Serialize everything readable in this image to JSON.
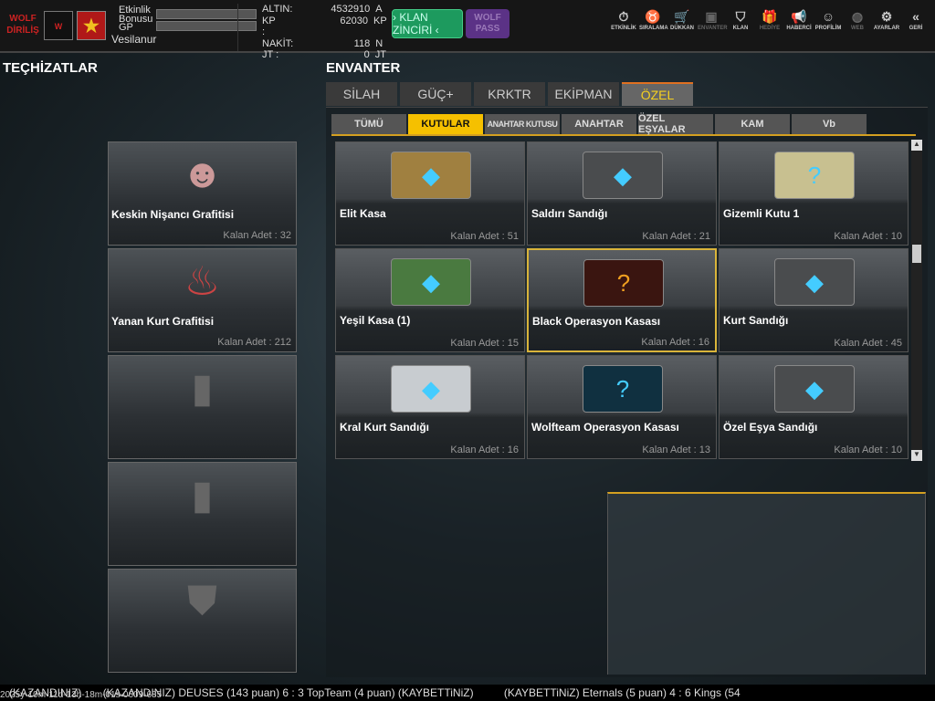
{
  "top": {
    "logo1": "WOLF DİRİLİŞ",
    "bonus_label": "Etkinlik Bonusu",
    "gp_label": "GP",
    "username": "Vesilanur",
    "currencies": [
      {
        "k": "ALTIN:",
        "v": "4532910",
        "u": "A"
      },
      {
        "k": "KP :",
        "v": "62030",
        "u": "KP"
      },
      {
        "k": "NAKİT:",
        "v": "118",
        "u": "N"
      },
      {
        "k": "JT :",
        "v": "0",
        "u": "JT"
      }
    ],
    "klan_button": "› KLAN ZİNCİRİ ‹",
    "wolf_pass": "WOLF PASS",
    "nav": [
      {
        "icon": "⏱",
        "label": "ETKİNLİK"
      },
      {
        "icon": "♉",
        "label": "SIRALAMA"
      },
      {
        "icon": "🛒",
        "label": "DÜKKAN"
      },
      {
        "icon": "▣",
        "label": "ENVANTER"
      },
      {
        "icon": "⛉",
        "label": "KLAN"
      },
      {
        "icon": "🎁",
        "label": "HEDİYE"
      },
      {
        "icon": "📢",
        "label": "HABERCİ"
      },
      {
        "icon": "☺",
        "label": "PROFİLİM"
      },
      {
        "icon": "◍",
        "label": "WEB"
      },
      {
        "icon": "⚙",
        "label": "AYARLAR"
      },
      {
        "icon": "«",
        "label": "GERİ"
      }
    ]
  },
  "left": {
    "title": "TEÇHİZATLAR",
    "items": [
      {
        "name": "Keskin Nişancı Grafitisi",
        "count": "Kalan Adet : 32"
      },
      {
        "name": "Yanan Kurt Grafitisi",
        "count": "Kalan Adet : 212"
      }
    ]
  },
  "inventory": {
    "title": "ENVANTER",
    "tabs": [
      "SİLAH",
      "GÜÇ+",
      "KRKTR",
      "EKİPMAN",
      "ÖZEL"
    ],
    "subtabs": [
      "TÜMÜ",
      "KUTULAR",
      "ANAHTAR KUTUSU",
      "ANAHTAR",
      "ÖZEL EŞYALAR",
      "KAM",
      "Vb"
    ],
    "items": [
      {
        "name": "Elit Kasa",
        "count": "Kalan Adet : 51",
        "color": "#a08040"
      },
      {
        "name": "Saldırı Sandığı",
        "count": "Kalan Adet : 21",
        "color": "#4a4c4e"
      },
      {
        "name": "Gizemli Kutu 1",
        "count": "Kalan Adet : 10",
        "color": "#c8c090"
      },
      {
        "name": "Yeşil Kasa (1)",
        "count": "Kalan Adet : 15",
        "color": "#4a7a40"
      },
      {
        "name": "Black Operasyon Kasası",
        "count": "Kalan Adet : 16",
        "color": "#3a1510"
      },
      {
        "name": "Kurt Sandığı",
        "count": "Kalan Adet : 45",
        "color": "#4a4c4e"
      },
      {
        "name": "Kral Kurt Sandığı",
        "count": "Kalan Adet : 16",
        "color": "#c8ccd0"
      },
      {
        "name": "Wolfteam Operasyon Kasası",
        "count": "Kalan Adet : 13",
        "color": "#103040"
      },
      {
        "name": "Özel Eşya Sandığı",
        "count": "Kalan Adet : 10",
        "color": "#4a4c4e"
      }
    ]
  },
  "ticker": "   (KAZANDINIZ)       (KAZANDINIZ) DEUSES (143 puan) 6 : 3 TopTeam (4 puan) (KAYBETTiNiZ)          (KAYBETTiNiZ) Eternals (5 puan) 4 : 6 Kings (54",
  "timestamp": "2025y-10m-11d-13h-18m-01s-0609-685"
}
